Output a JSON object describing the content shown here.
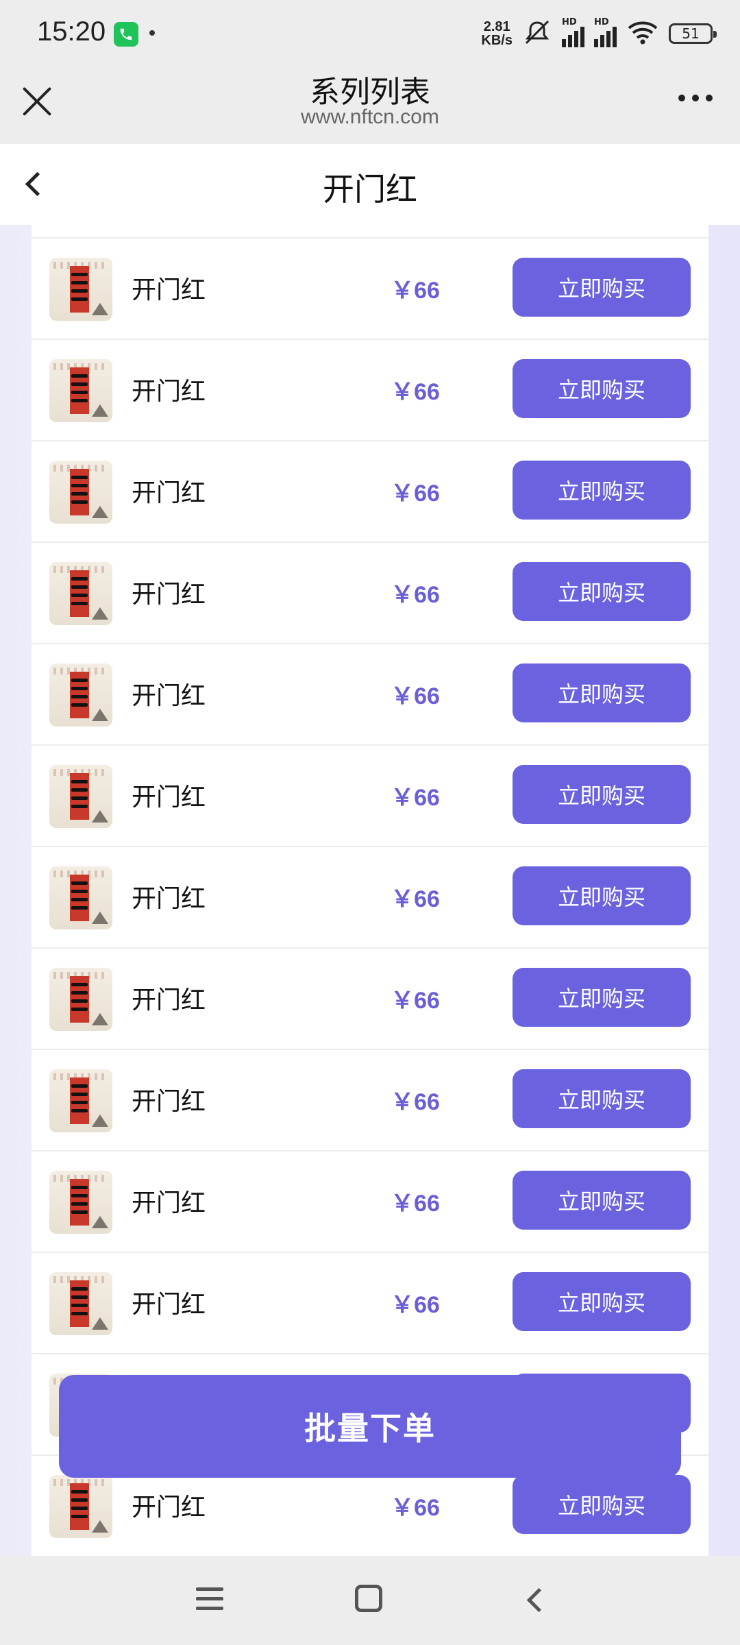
{
  "status_bar": {
    "time": "15:20",
    "net_speed_value": "2.81",
    "net_speed_unit": "KB/s",
    "battery_level": "51",
    "icons": [
      "call-icon",
      "mute-icon",
      "hd-signal-icon",
      "hd-signal-icon",
      "wifi-icon",
      "battery-icon"
    ]
  },
  "browser": {
    "title": "系列列表",
    "url": "www.nftcn.com"
  },
  "app_nav": {
    "title": "开门红"
  },
  "items": [
    {
      "name": "开门红",
      "price": "￥66",
      "button": "立即购买"
    },
    {
      "name": "开门红",
      "price": "￥66",
      "button": "立即购买"
    },
    {
      "name": "开门红",
      "price": "￥66",
      "button": "立即购买"
    },
    {
      "name": "开门红",
      "price": "￥66",
      "button": "立即购买"
    },
    {
      "name": "开门红",
      "price": "￥66",
      "button": "立即购买"
    },
    {
      "name": "开门红",
      "price": "￥66",
      "button": "立即购买"
    },
    {
      "name": "开门红",
      "price": "￥66",
      "button": "立即购买"
    },
    {
      "name": "开门红",
      "price": "￥66",
      "button": "立即购买"
    },
    {
      "name": "开门红",
      "price": "￥66",
      "button": "立即购买"
    },
    {
      "name": "开门红",
      "price": "￥66",
      "button": "立即购买"
    },
    {
      "name": "开门红",
      "price": "￥66",
      "button": "立即购买"
    },
    {
      "name": "开门红",
      "price": "￥66",
      "button": "立即购买"
    },
    {
      "name": "开门红",
      "price": "￥66",
      "button": "立即购买"
    }
  ],
  "batch_button": "批量下单",
  "colors": {
    "accent": "#6b62e0",
    "price": "#6a5fd9",
    "background_tint": "#ecebfa"
  }
}
